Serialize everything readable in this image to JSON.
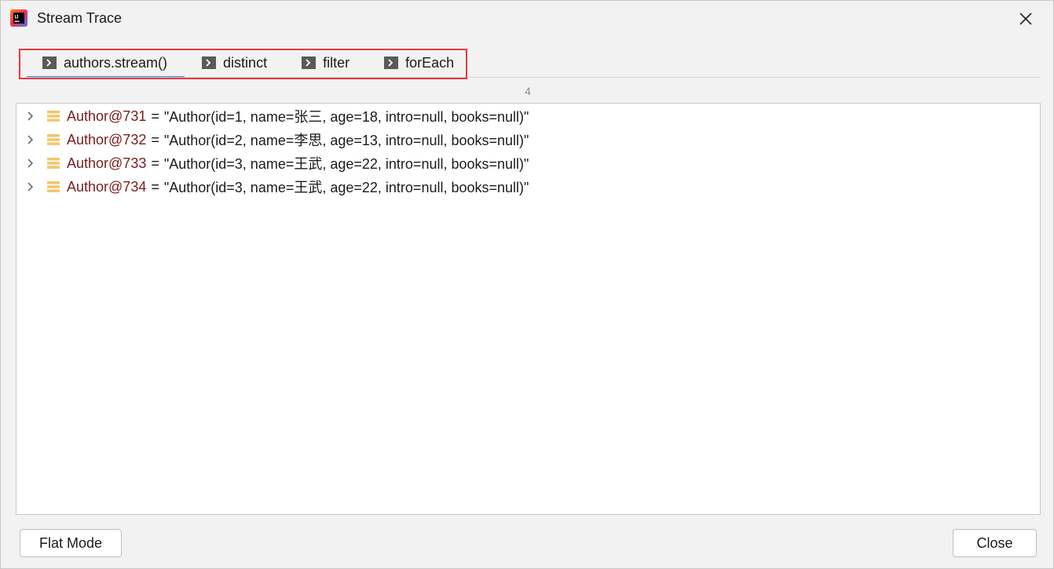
{
  "window": {
    "title": "Stream Trace",
    "app_icon": "intellij-idea-icon",
    "close_icon": "close-icon"
  },
  "tabs": [
    {
      "label": "authors.stream()",
      "active": true,
      "icon": "terminal-arrow-icon"
    },
    {
      "label": "distinct",
      "active": false,
      "icon": "terminal-arrow-icon"
    },
    {
      "label": "filter",
      "active": false,
      "icon": "terminal-arrow-icon"
    },
    {
      "label": "forEach",
      "active": false,
      "icon": "terminal-arrow-icon"
    }
  ],
  "count": "4",
  "items": [
    {
      "ref": "Author@731",
      "eq": "=",
      "value": "\"Author(id=1, name=张三, age=18, intro=null, books=null)\""
    },
    {
      "ref": "Author@732",
      "eq": "=",
      "value": "\"Author(id=2, name=李思, age=13, intro=null, books=null)\""
    },
    {
      "ref": "Author@733",
      "eq": "=",
      "value": "\"Author(id=3, name=王武, age=22, intro=null, books=null)\""
    },
    {
      "ref": "Author@734",
      "eq": "=",
      "value": "\"Author(id=3, name=王武, age=22, intro=null, books=null)\""
    }
  ],
  "buttons": {
    "flat_mode": "Flat Mode",
    "close": "Close"
  },
  "colors": {
    "accent": "#4a7fd1",
    "highlight": "#e8383d",
    "reference": "#7a1c1c",
    "object_icon": "#f5c46a"
  }
}
